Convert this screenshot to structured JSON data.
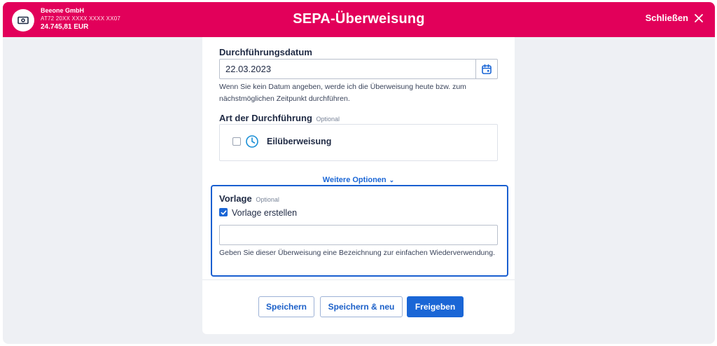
{
  "header": {
    "account_name": "Beeone GmbH",
    "account_iban": "AT72 20XX XXXX XXXX XX07",
    "account_balance": "24.745,81 EUR",
    "title": "SEPA-Überweisung",
    "close_label": "Schließen"
  },
  "form": {
    "date": {
      "label": "Durchführungsdatum",
      "value": "22.03.2023",
      "hint": "Wenn Sie kein Datum angeben, werde ich die Überweisung heute bzw. zum nächstmöglichen Zeitpunkt durchführen."
    },
    "execution": {
      "label": "Art der Durchführung",
      "optional": "Optional",
      "option_label": "Eilüberweisung",
      "checked": false
    },
    "more_options_label": "Weitere Optionen",
    "template": {
      "label": "Vorlage",
      "optional": "Optional",
      "checkbox_label": "Vorlage erstellen",
      "checked": true,
      "input_value": "",
      "hint": "Geben Sie dieser Überweisung eine Bezeichnung zur einfachen Wiederverwendung."
    }
  },
  "actions": {
    "save": "Speichern",
    "save_new": "Speichern & neu",
    "release": "Freigeben"
  },
  "colors": {
    "brand": "#e2005a",
    "primary": "#1a66d6",
    "focus_border": "#1a5fd0"
  }
}
